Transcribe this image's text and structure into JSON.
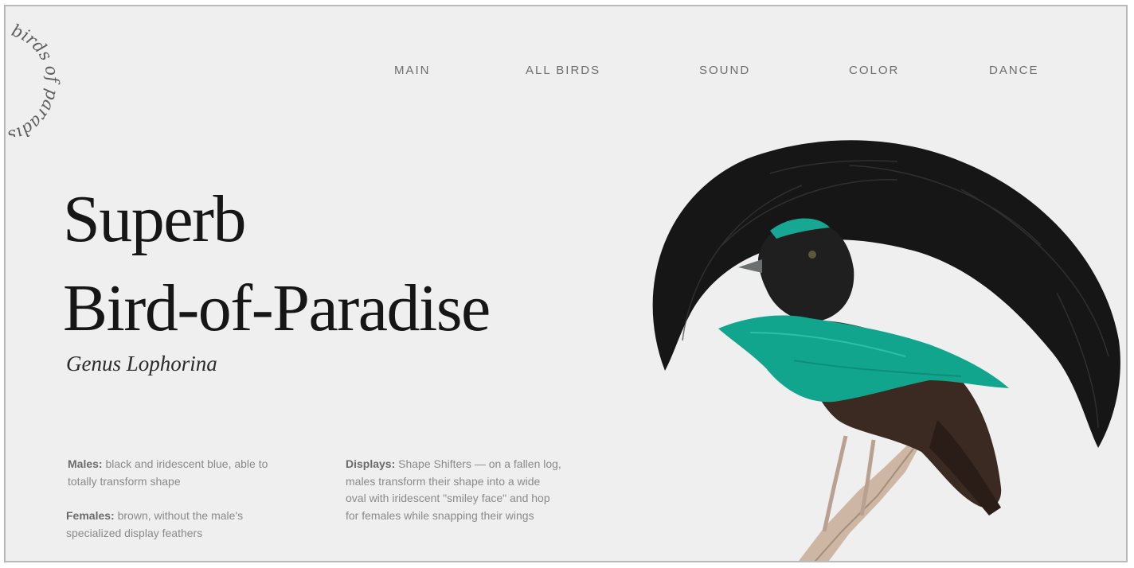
{
  "logo": {
    "text": "birds of paradise"
  },
  "nav": {
    "items": [
      "MAIN",
      "ALL BIRDS",
      "SOUND",
      "COLOR",
      "DANCE"
    ]
  },
  "hero": {
    "title_line1": "Superb",
    "title_line2": "Bird-of-Paradise",
    "genus": "Genus Lophorina"
  },
  "facts": {
    "males_label": "Males:",
    "males_text": " black and iridescent blue, able to totally transform shape",
    "females_label": "Females:",
    "females_text": " brown, without the male's specialized display feathers",
    "displays_label": "Displays:",
    "displays_text": " Shape Shifters — on a fallen log, males transform their shape into a wide oval with iridescent \"smiley face\" and hop for females while snapping their wings"
  },
  "colors": {
    "background": "#efefef",
    "plumage_black": "#161616",
    "iridescent_teal": "#12a58e"
  },
  "image": {
    "subject": "superb bird-of-paradise perched on branch"
  }
}
